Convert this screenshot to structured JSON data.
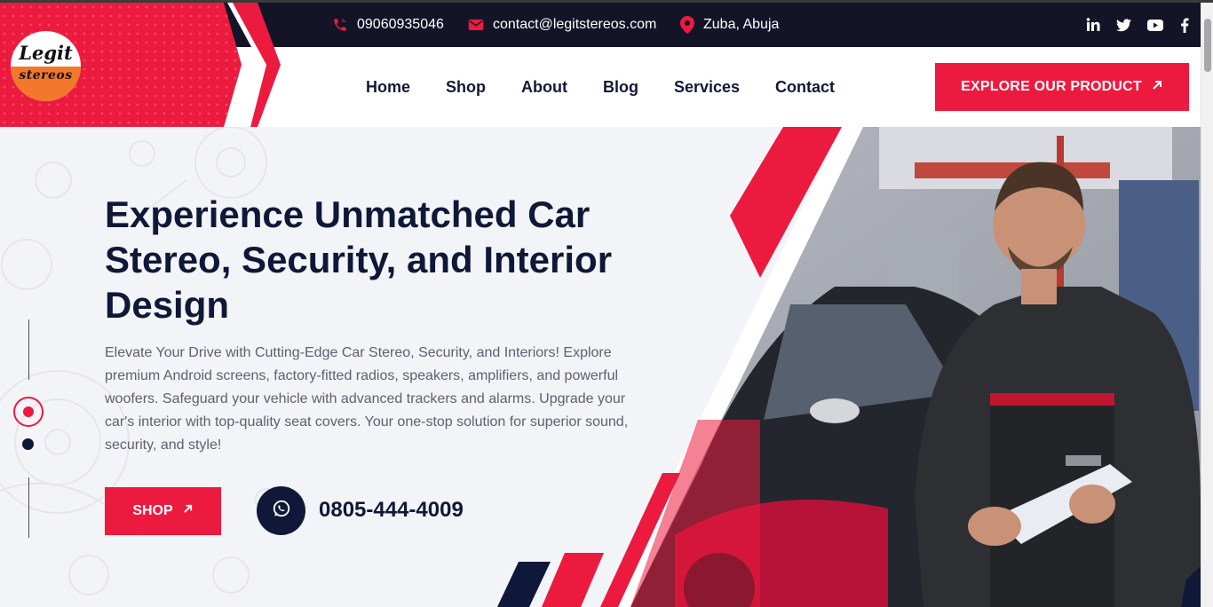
{
  "topbar": {
    "phone": "09060935046",
    "email": "contact@legitstereos.com",
    "location": "Zuba, Abuja",
    "social_icons": [
      "linkedin-icon",
      "twitter-icon",
      "youtube-icon",
      "facebook-icon"
    ]
  },
  "logo": {
    "line1": "Legit",
    "line2": "stereos"
  },
  "nav": {
    "items": [
      "Home",
      "Shop",
      "About",
      "Blog",
      "Services",
      "Contact"
    ],
    "cta_label": "EXPLORE OUR PRODUCT"
  },
  "hero": {
    "title": "Experience Unmatched Car Stereo, Security, and Interior Design",
    "description": "Elevate Your Drive with Cutting-Edge Car Stereo, Security, and Interiors! Explore premium Android screens, factory-fitted radios, speakers, amplifiers, and powerful woofers. Safeguard your vehicle with advanced trackers and alarms. Upgrade your car's interior with top-quality seat covers. Your one-stop solution for superior sound, security, and style!",
    "shop_label": "SHOP",
    "phone": "0805-444-4009"
  },
  "colors": {
    "accent": "#ec1a3e",
    "navy": "#0f1836",
    "topbar": "#141428"
  }
}
